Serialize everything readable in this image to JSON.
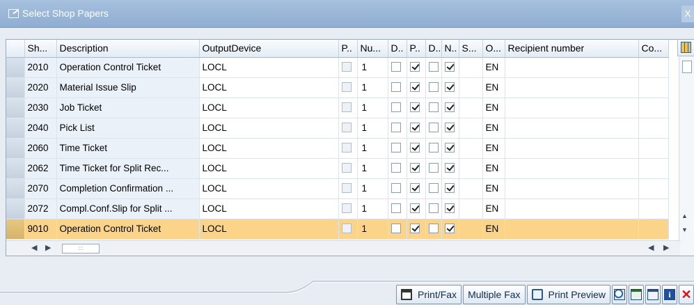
{
  "dialog": {
    "title": "Select Shop Papers",
    "close_label": "X"
  },
  "grid": {
    "headers": [
      "Sh...",
      "Description",
      "OutputDevice",
      "P..",
      "Nu...",
      "D..",
      "P..",
      "D..",
      "N..",
      "S...",
      "O...",
      "Recipient number",
      "Co..."
    ],
    "rows": [
      {
        "shop": "2010",
        "desc": "Operation Control Ticket",
        "device": "LOCL",
        "p": false,
        "num": "1",
        "d1": false,
        "p2": true,
        "d2": false,
        "n": true,
        "lang": "EN"
      },
      {
        "shop": "2020",
        "desc": "Material Issue Slip",
        "device": "LOCL",
        "p": false,
        "num": "1",
        "d1": false,
        "p2": true,
        "d2": false,
        "n": true,
        "lang": "EN"
      },
      {
        "shop": "2030",
        "desc": "Job Ticket",
        "device": "LOCL",
        "p": false,
        "num": "1",
        "d1": false,
        "p2": true,
        "d2": false,
        "n": true,
        "lang": "EN"
      },
      {
        "shop": "2040",
        "desc": "Pick List",
        "device": "LOCL",
        "p": false,
        "num": "1",
        "d1": false,
        "p2": true,
        "d2": false,
        "n": true,
        "lang": "EN"
      },
      {
        "shop": "2060",
        "desc": "Time Ticket",
        "device": "LOCL",
        "p": false,
        "num": "1",
        "d1": false,
        "p2": true,
        "d2": false,
        "n": true,
        "lang": "EN"
      },
      {
        "shop": "2062",
        "desc": "Time Ticket for Split Rec...",
        "device": "LOCL",
        "p": false,
        "num": "1",
        "d1": false,
        "p2": true,
        "d2": false,
        "n": true,
        "lang": "EN"
      },
      {
        "shop": "2070",
        "desc": "Completion Confirmation ...",
        "device": "LOCL",
        "p": false,
        "num": "1",
        "d1": false,
        "p2": true,
        "d2": false,
        "n": true,
        "lang": "EN"
      },
      {
        "shop": "2072",
        "desc": "Compl.Conf.Slip for Split ...",
        "device": "LOCL",
        "p": false,
        "num": "1",
        "d1": false,
        "p2": true,
        "d2": false,
        "n": true,
        "lang": "EN"
      },
      {
        "shop": "9010",
        "desc": "Operation Control Ticket",
        "device": "LOCL",
        "p": false,
        "num": "1",
        "d1": false,
        "p2": true,
        "d2": false,
        "n": true,
        "lang": "EN",
        "selected": true
      }
    ],
    "hscroll_thumb": ":::"
  },
  "toolbar": {
    "print_fax": "Print/Fax",
    "multiple_fax": "Multiple Fax",
    "print_preview": "Print Preview",
    "info_glyph": "i",
    "cancel_glyph": "✕"
  },
  "colors": {
    "titlebar": "#8fadd2",
    "selected_row": "#fbd48a",
    "key_column": "#eaf1f8",
    "cancel": "#dd1111"
  }
}
